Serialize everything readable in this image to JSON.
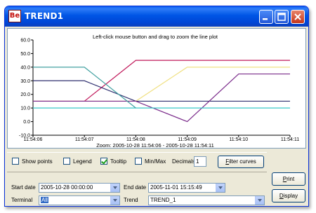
{
  "window": {
    "title": "TREND1",
    "logo_text": "Be"
  },
  "colors": {
    "titlebar": "#0055e5",
    "close": "#c5371c"
  },
  "plot": {
    "hint": "Left-click mouse button and drag to zoom the line plot",
    "zoom_label": "Zoom: 2005-10-28 11:54:06 - 2005-10-28 11:54:11"
  },
  "chart_data": {
    "type": "line",
    "title": "Left-click mouse button and drag to zoom the line plot",
    "xlabel": "Zoom: 2005-10-28 11:54:06 - 2005-10-28 11:54:11",
    "ylabel": "",
    "x_tick_labels": [
      "11:54:06",
      "11:54:07",
      "11:54:08",
      "11:54:09",
      "11:54:10",
      "11:54:11"
    ],
    "y_tick_labels": [
      "60.0",
      "50.0",
      "40.0",
      "30.0",
      "20.0",
      "10.0",
      "0.0",
      "-10.0"
    ],
    "ylim": [
      -10,
      60
    ],
    "xlim": [
      0,
      5
    ],
    "grid": false,
    "series": [
      {
        "color": "#c0185a",
        "x": [
          0,
          1,
          2,
          5
        ],
        "y": [
          15,
          15,
          45,
          45
        ]
      },
      {
        "color": "#f0e080",
        "x": [
          0,
          1,
          2,
          3,
          5
        ],
        "y": [
          15,
          15,
          15,
          40,
          40
        ]
      },
      {
        "color": "#303070",
        "x": [
          0,
          1,
          2,
          5
        ],
        "y": [
          30,
          30,
          15,
          15
        ]
      },
      {
        "color": "#7a2a8a",
        "x": [
          0,
          1,
          2,
          3,
          4,
          5
        ],
        "y": [
          15,
          15,
          15,
          0,
          35,
          35
        ]
      },
      {
        "color": "#38c8c8",
        "x": [
          0,
          5
        ],
        "y": [
          10,
          10
        ]
      },
      {
        "color": "#40a0a0",
        "x": [
          0,
          1,
          2
        ],
        "y": [
          40,
          40,
          10
        ]
      }
    ]
  },
  "options": {
    "show_points": {
      "label": "Show points",
      "checked": false
    },
    "legend": {
      "label": "Legend",
      "checked": false
    },
    "tooltip": {
      "label": "Tooltip",
      "checked": true
    },
    "minmax": {
      "label": "Min/Max",
      "checked": false
    },
    "decimals_label": "Decimals:",
    "decimals_value": "1",
    "filter_button": "Filter curves",
    "filter_button_rest": "ilter curves"
  },
  "selection": {
    "start_label": "Start date",
    "start_value": "2005-10-28 00:00:00",
    "end_label": "End date",
    "end_value": "2005-11-01 15:15:49",
    "terminal_label": "Terminal",
    "terminal_value": "All",
    "trend_label": "Trend",
    "trend_value": "TREND_1"
  },
  "buttons": {
    "print": "Print",
    "print_first": "P",
    "print_rest": "rint",
    "display": "Display",
    "display_first": "D",
    "display_rest": "isplay"
  }
}
